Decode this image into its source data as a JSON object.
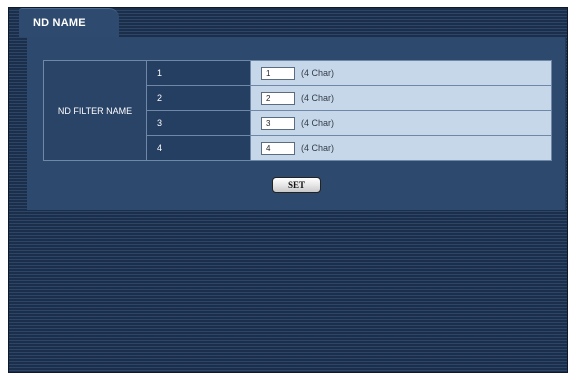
{
  "tab": {
    "label": "ND NAME"
  },
  "nd_filter": {
    "group_label": "ND FILTER NAME",
    "rows": [
      {
        "number": "1",
        "value": "1",
        "hint": "(4 Char)"
      },
      {
        "number": "2",
        "value": "2",
        "hint": "(4 Char)"
      },
      {
        "number": "3",
        "value": "3",
        "hint": "(4 Char)"
      },
      {
        "number": "4",
        "value": "4",
        "hint": "(4 Char)"
      }
    ]
  },
  "actions": {
    "set_label": "SET"
  },
  "colors": {
    "background": "#1b2e4a",
    "panel": "#2d4a6e",
    "input_cell": "#c7d7ea"
  }
}
